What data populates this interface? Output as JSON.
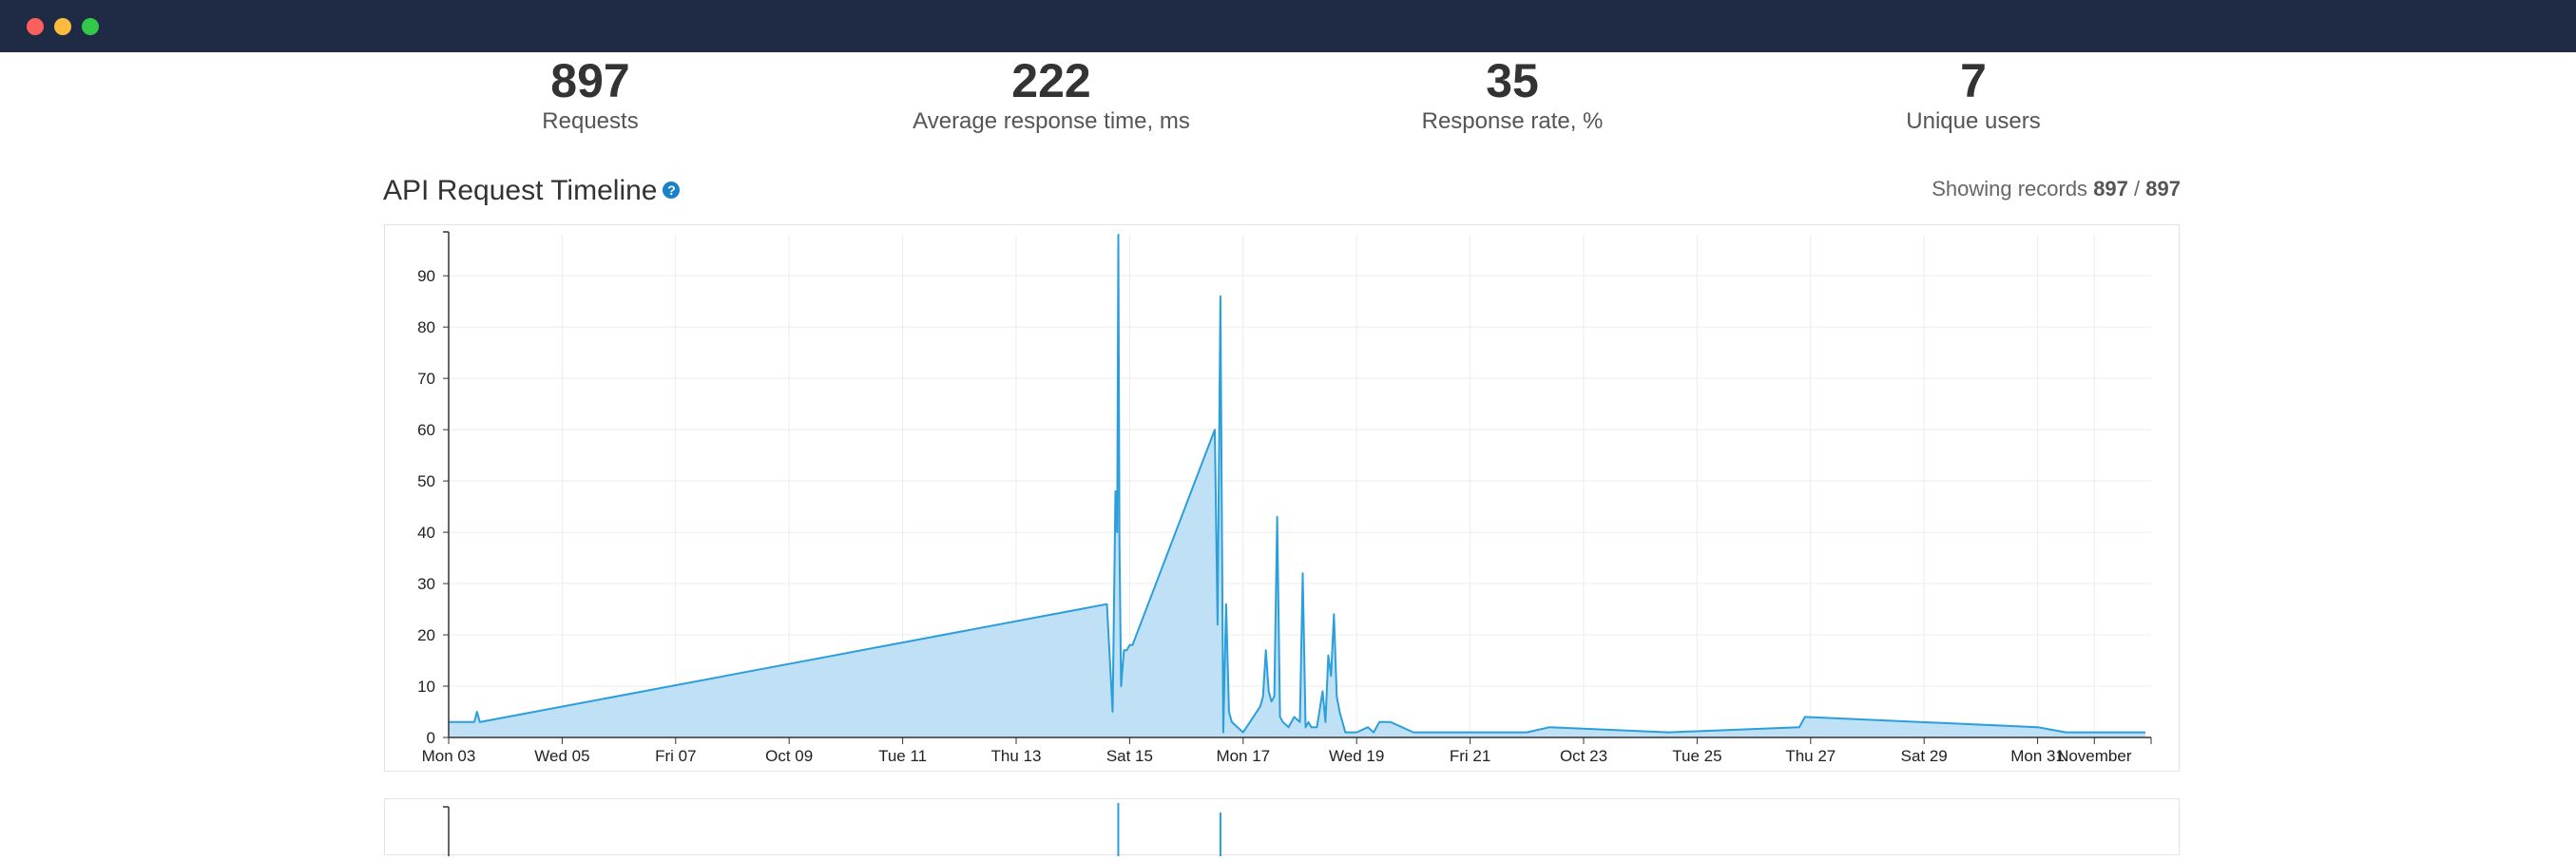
{
  "window": {
    "controls": [
      "close",
      "minimize",
      "maximize"
    ]
  },
  "stats": [
    {
      "value": "897",
      "label": "Requests"
    },
    {
      "value": "222",
      "label": "Average response time, ms"
    },
    {
      "value": "35",
      "label": "Response rate, %"
    },
    {
      "value": "7",
      "label": "Unique users"
    }
  ],
  "timeline": {
    "title": "API Request Timeline",
    "help_icon": "?",
    "records_prefix": "Showing records",
    "records_shown": "897",
    "records_sep": "/",
    "records_total": "897"
  },
  "colors": {
    "line": "#2b9fdb",
    "fill": "#bfe0f5",
    "titlebar": "#1f2a44"
  },
  "chart_data": {
    "type": "area",
    "title": "",
    "xlabel": "",
    "ylabel": "",
    "ylim": [
      0,
      98
    ],
    "xlim": [
      0,
      30
    ],
    "grid": true,
    "y_ticks": [
      0,
      10,
      20,
      30,
      40,
      50,
      60,
      70,
      80,
      90
    ],
    "x_ticks": [
      {
        "x": 0,
        "label": "Mon 03"
      },
      {
        "x": 2,
        "label": "Wed 05"
      },
      {
        "x": 4,
        "label": "Fri 07"
      },
      {
        "x": 6,
        "label": "Oct 09"
      },
      {
        "x": 8,
        "label": "Tue 11"
      },
      {
        "x": 10,
        "label": "Thu 13"
      },
      {
        "x": 12,
        "label": "Sat 15"
      },
      {
        "x": 14,
        "label": "Mon 17"
      },
      {
        "x": 16,
        "label": "Wed 19"
      },
      {
        "x": 18,
        "label": "Fri 21"
      },
      {
        "x": 20,
        "label": "Oct 23"
      },
      {
        "x": 22,
        "label": "Tue 25"
      },
      {
        "x": 24,
        "label": "Thu 27"
      },
      {
        "x": 26,
        "label": "Sat 29"
      },
      {
        "x": 28,
        "label": "Mon 31"
      },
      {
        "x": 29,
        "label": "November"
      }
    ],
    "series": [
      {
        "x": [
          0,
          0.45,
          0.5,
          0.55,
          11.6,
          11.7,
          11.75,
          11.78,
          11.8,
          11.82,
          11.85,
          11.9,
          11.95,
          12.0,
          12.05,
          13.5,
          13.55,
          13.6,
          13.65,
          13.7,
          13.75,
          13.8,
          13.9,
          14.0,
          14.3,
          14.35,
          14.4,
          14.45,
          14.5,
          14.55,
          14.6,
          14.65,
          14.7,
          14.8,
          14.9,
          15.0,
          15.05,
          15.1,
          15.15,
          15.2,
          15.3,
          15.4,
          15.45,
          15.5,
          15.55,
          15.6,
          15.65,
          15.7,
          15.8,
          16.0,
          16.2,
          16.3,
          16.4,
          16.6,
          17.0,
          19.0,
          19.4,
          21.5,
          23.8,
          23.9,
          28.0,
          28.5,
          29.9
        ],
        "y": [
          3,
          3,
          5,
          3,
          26,
          5,
          48,
          40,
          98,
          38,
          10,
          17,
          17,
          18,
          18,
          60,
          22,
          86,
          1,
          26,
          5,
          3,
          2,
          1,
          6,
          8,
          17,
          9,
          7,
          8,
          43,
          4,
          3,
          2,
          4,
          3,
          32,
          2,
          3,
          2,
          2,
          9,
          3,
          16,
          12,
          24,
          8,
          5,
          1,
          1,
          2,
          1,
          3,
          3,
          1,
          1,
          2,
          1,
          2,
          4,
          2,
          1,
          1
        ]
      }
    ]
  }
}
